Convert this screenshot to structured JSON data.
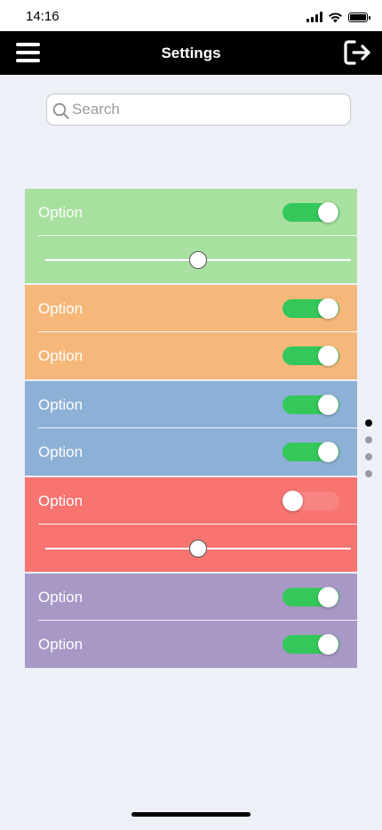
{
  "status_bar": {
    "time": "14:16"
  },
  "nav": {
    "title": "Settings",
    "menu_icon": "hamburger-menu-icon",
    "logout_icon": "logout-arrow-icon"
  },
  "search": {
    "placeholder": "Search",
    "value": "",
    "icon": "search-icon"
  },
  "sections": [
    {
      "color": "#a8e0a0",
      "rows": [
        {
          "type": "toggle",
          "label": "Option",
          "on": true
        },
        {
          "type": "slider",
          "value": 0.5
        }
      ]
    },
    {
      "color": "#f5b87a",
      "rows": [
        {
          "type": "toggle",
          "label": "Option",
          "on": true
        },
        {
          "type": "toggle",
          "label": "Option",
          "on": true
        }
      ]
    },
    {
      "color": "#8db0d6",
      "rows": [
        {
          "type": "toggle",
          "label": "Option",
          "on": true
        },
        {
          "type": "toggle",
          "label": "Option",
          "on": true
        }
      ]
    },
    {
      "color": "#f77470",
      "rows": [
        {
          "type": "toggle",
          "label": "Option",
          "on": false
        },
        {
          "type": "slider",
          "value": 0.5
        }
      ]
    },
    {
      "color": "#a898c6",
      "rows": [
        {
          "type": "toggle",
          "label": "Option",
          "on": true
        },
        {
          "type": "toggle",
          "label": "Option",
          "on": true
        }
      ]
    }
  ],
  "page_indicator": {
    "count": 4,
    "active_index": 0
  },
  "colors": {
    "toggle_on": "#34c759",
    "nav_background": "#000000",
    "page_background": "#eef0f7"
  }
}
